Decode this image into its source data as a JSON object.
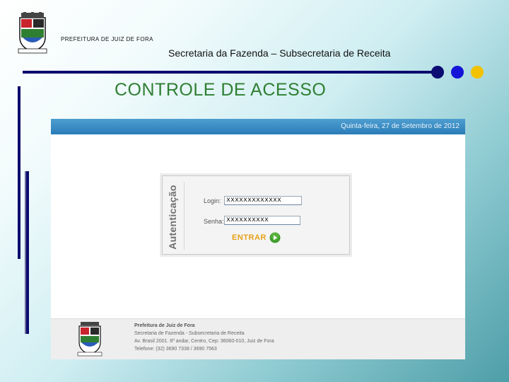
{
  "header": {
    "org_name": "PREFEITURA DE JUIZ DE FORA",
    "subtitle": "Secretaria da Fazenda – Subsecretaria de Receita",
    "page_title": "CONTROLE  DE  ACESSO"
  },
  "colors": {
    "title_green": "#2f7f32",
    "navy": "#0a0a6e",
    "blue": "#1515d8",
    "yellow": "#f2c200",
    "header_blue": "#2a7cb8",
    "button_orange": "#e8a21a"
  },
  "screenshot": {
    "date": "Quinta-feira, 27 de Setembro de 2012",
    "login_form": {
      "heading": "Autenticação",
      "login_label": "Login:",
      "login_value": "xxxxxxxxxxxxx",
      "senha_label": "Senha:",
      "senha_value": "xxxxxxxxxx",
      "submit_label": "ENTRAR",
      "submit_icon": "arrow-right-circle-icon"
    },
    "footer": {
      "line1": "Prefeitura de Juiz de Fora",
      "line2": "Secretaria de Fazenda - Subsecretaria de Receita",
      "line3": "Av. Brasil 2001. 6º andar, Centro, Cep: 36060-010, Juiz de Fora",
      "line4": "Telefone: (32) 3690 7338 / 3690 7563"
    }
  }
}
